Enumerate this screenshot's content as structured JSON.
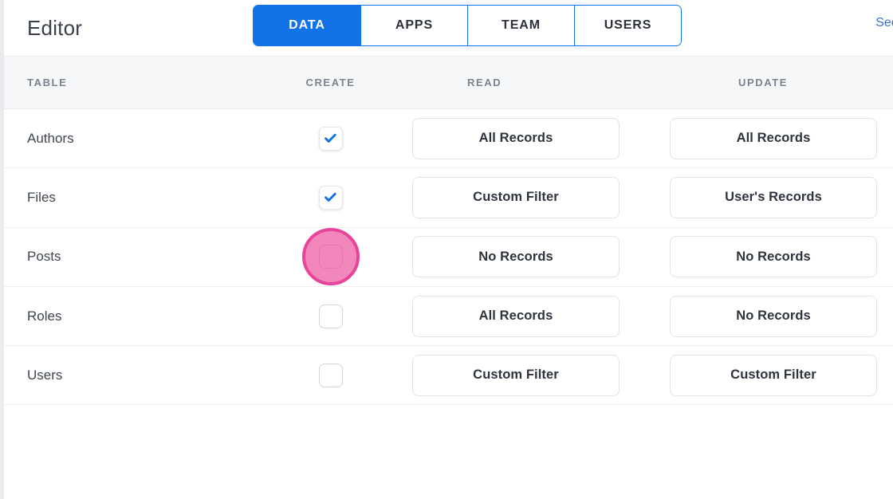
{
  "header": {
    "title": "Editor",
    "tabs": [
      {
        "label": "DATA",
        "active": true
      },
      {
        "label": "APPS",
        "active": false
      },
      {
        "label": "TEAM",
        "active": false
      },
      {
        "label": "USERS",
        "active": false
      }
    ],
    "see_all_link": "See a"
  },
  "table": {
    "columns": [
      "TABLE",
      "CREATE",
      "READ",
      "UPDATE"
    ],
    "rows": [
      {
        "name": "Authors",
        "create": true,
        "read": "All Records",
        "update": "All Records",
        "highlighted": false
      },
      {
        "name": "Files",
        "create": true,
        "read": "Custom Filter",
        "update": "User's Records",
        "highlighted": false
      },
      {
        "name": "Posts",
        "create": false,
        "read": "No Records",
        "update": "No Records",
        "highlighted": true
      },
      {
        "name": "Roles",
        "create": false,
        "read": "All Records",
        "update": "No Records",
        "highlighted": false
      },
      {
        "name": "Users",
        "create": false,
        "read": "Custom Filter",
        "update": "Custom Filter",
        "highlighted": false
      }
    ]
  },
  "colors": {
    "accent": "#1272e8",
    "link": "#3874cb",
    "cursor_halo_fill": "#f287bb",
    "cursor_halo_ring": "#e8459a",
    "header_band": "#f6f7f9",
    "text_primary": "#2e343d",
    "text_muted": "#7b838f"
  }
}
